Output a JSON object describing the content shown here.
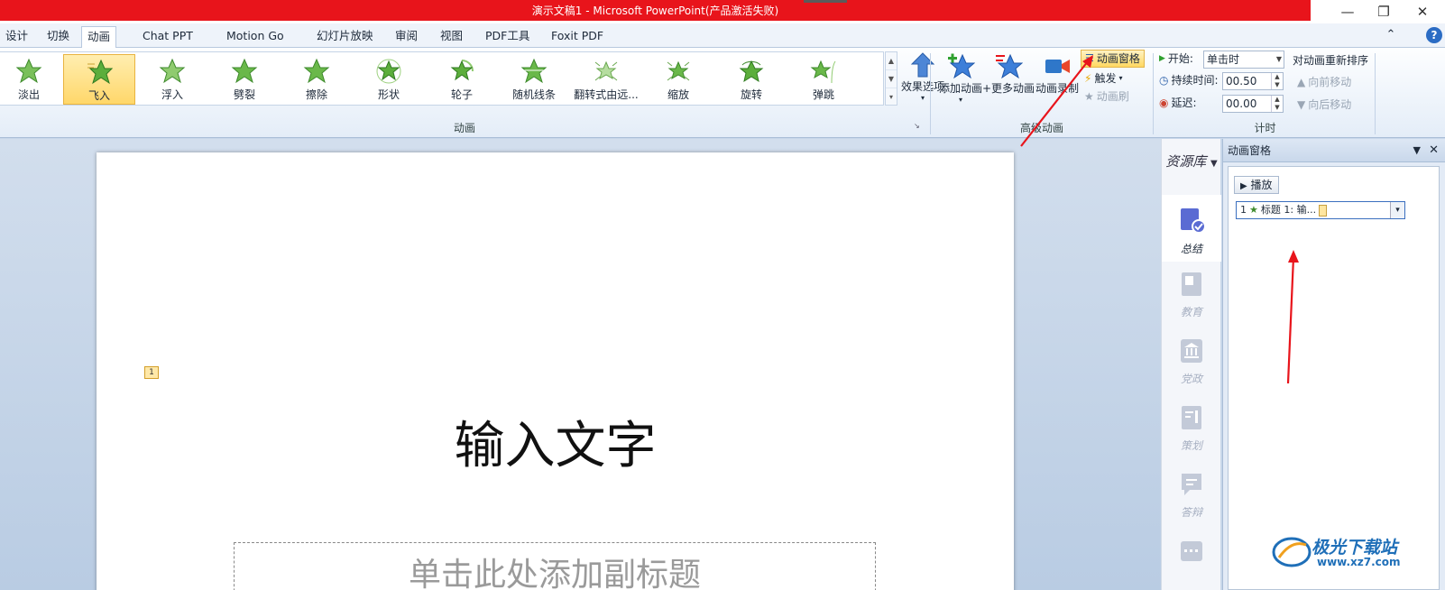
{
  "titlebar": {
    "title": "演示文稿1 - Microsoft PowerPoint(产品激活失败)",
    "accent": "#e8141b"
  },
  "tabs": [
    {
      "label": "设计"
    },
    {
      "label": "切换"
    },
    {
      "label": "动画",
      "active": true
    },
    {
      "label": "Chat PPT"
    },
    {
      "label": "Motion Go"
    },
    {
      "label": "幻灯片放映"
    },
    {
      "label": "审阅"
    },
    {
      "label": "视图"
    },
    {
      "label": "PDF工具"
    },
    {
      "label": "Foxit PDF"
    }
  ],
  "animation_gallery": {
    "items": [
      {
        "label": "淡出"
      },
      {
        "label": "飞入",
        "selected": true
      },
      {
        "label": "浮入"
      },
      {
        "label": "劈裂"
      },
      {
        "label": "擦除"
      },
      {
        "label": "形状"
      },
      {
        "label": "轮子"
      },
      {
        "label": "随机线条"
      },
      {
        "label": "翻转式由远..."
      },
      {
        "label": "缩放"
      },
      {
        "label": "旋转"
      },
      {
        "label": "弹跳"
      }
    ],
    "effect_options": "效果选项",
    "group_label": "动画"
  },
  "advanced": {
    "add_animation": "添加动画",
    "more_animation": "+更多动画",
    "animation_record": "动画录制",
    "animation_pane": "动画窗格",
    "trigger": "触发",
    "animation_painter": "动画刷",
    "group_label": "高级动画"
  },
  "timing": {
    "start_label": "开始:",
    "start_value": "单击时",
    "duration_label": "持续时间:",
    "duration_value": "00.50",
    "delay_label": "延迟:",
    "delay_value": "00.00",
    "reorder_title": "对动画重新排序",
    "move_earlier": "向前移动",
    "move_later": "向后移动",
    "group_label": "计时"
  },
  "slide": {
    "title": "输入文字",
    "subtitle": "单击此处添加副标题",
    "anim_tag": "1"
  },
  "resources": {
    "header": "资源库",
    "items": [
      {
        "label": "总结"
      },
      {
        "label": "教育"
      },
      {
        "label": "党政"
      },
      {
        "label": "策划"
      },
      {
        "label": "答辩"
      }
    ]
  },
  "animation_pane": {
    "title": "动画窗格",
    "play": "播放",
    "item_number": "1",
    "item_text": "标题 1: 输..."
  },
  "watermark": {
    "name": "极光下载站",
    "url": "www.xz7.com"
  }
}
